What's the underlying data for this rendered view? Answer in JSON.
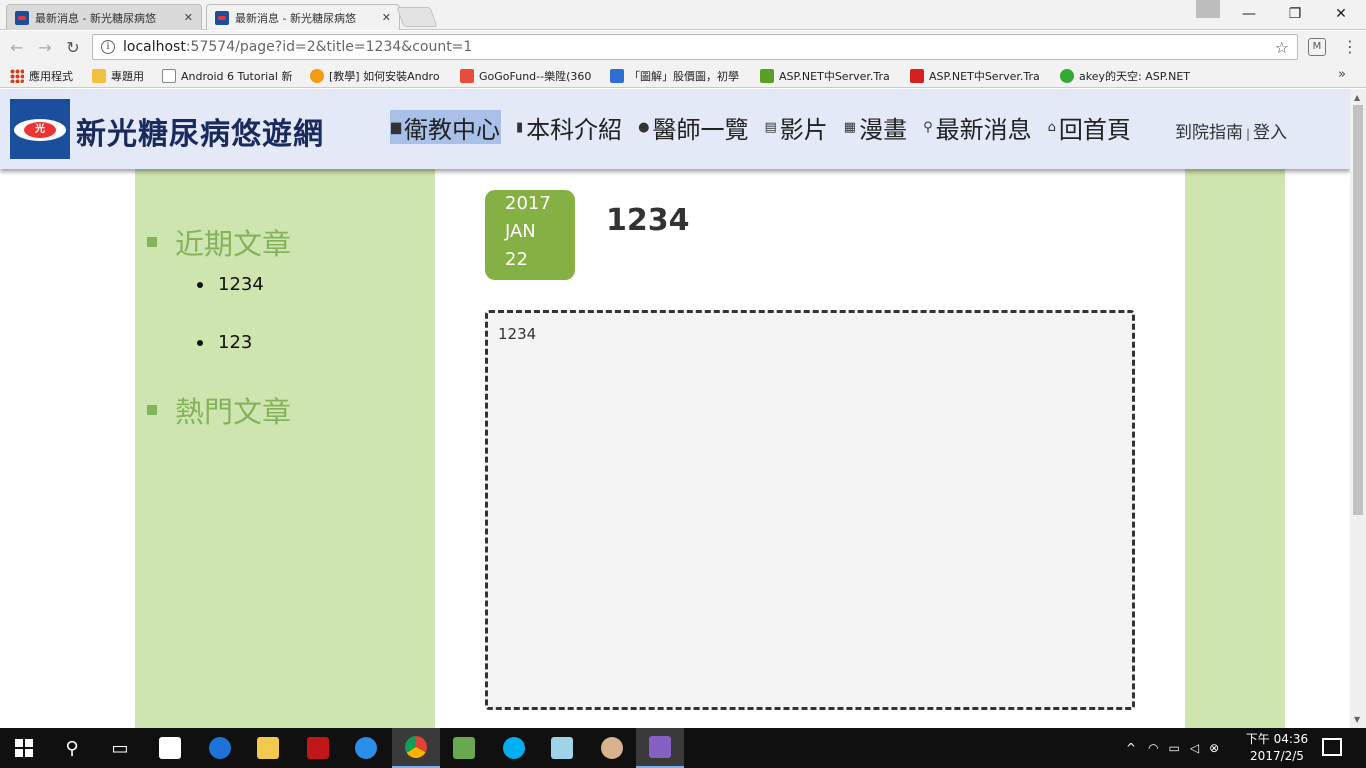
{
  "browser": {
    "tabs": [
      {
        "title": "最新消息 - 新光糖尿病悠",
        "active": false
      },
      {
        "title": "最新消息 - 新光糖尿病悠",
        "active": true
      }
    ],
    "close_glyph": "✕",
    "window_controls": {
      "minimize": "—",
      "restore": "❐",
      "close": "✕"
    },
    "url_host": "localhost",
    "url_rest": ":57574/page?id=2&title=1234&count=1",
    "bookmarks": [
      {
        "label": "應用程式",
        "color": "#d04020"
      },
      {
        "label": "專題用",
        "color": "#f0c040"
      },
      {
        "label": "Android 6 Tutorial 新",
        "color": "#ffffff"
      },
      {
        "label": "[教學] 如何安裝Andro",
        "color": "#f39c12"
      },
      {
        "label": "GoGoFund--樂陞(360",
        "color": "#e74c3c"
      },
      {
        "label": "「圖解」股價圖，初學",
        "color": "#2e6fd1"
      },
      {
        "label": "ASP.NET中Server.Tra",
        "color": "#5a9e2a"
      },
      {
        "label": "ASP.NET中Server.Tra",
        "color": "#d62020"
      },
      {
        "label": "akey的天空: ASP.NET",
        "color": "#33aa33"
      }
    ],
    "more_bookmarks": "»"
  },
  "site": {
    "title": "新光糖尿病悠遊網",
    "logo_text": "光",
    "nav": [
      {
        "label": "衛教中心",
        "icon": "▆",
        "active": true
      },
      {
        "label": "本科介紹",
        "icon": "🔖",
        "active": false
      },
      {
        "label": "醫師一覽",
        "icon": "👤",
        "active": false
      },
      {
        "label": "影片",
        "icon": "🎞",
        "active": false
      },
      {
        "label": "漫畫",
        "icon": "▦",
        "active": false
      },
      {
        "label": "最新消息",
        "icon": "🔍",
        "active": false
      },
      {
        "label": "回首頁",
        "icon": "⌂",
        "active": false
      }
    ],
    "util_links": {
      "guide": "到院指南",
      "sep": "|",
      "login": "登入"
    },
    "sidebar": {
      "recent_heading": "近期文章",
      "recent_items": [
        "1234",
        "123"
      ],
      "popular_heading": "熱門文章"
    },
    "article": {
      "year": "2017",
      "month": "JAN",
      "day": "22",
      "title": "1234",
      "body": "1234"
    },
    "colors": {
      "header_bg": "#e3e9f6",
      "sidebar_bg": "#cfe5b0",
      "accent_green": "#85b35c",
      "date_badge": "#85b044",
      "brand_blue": "#1b4f9e"
    }
  },
  "taskbar": {
    "clock_time": "下午 04:36",
    "clock_date": "2017/2/5"
  }
}
